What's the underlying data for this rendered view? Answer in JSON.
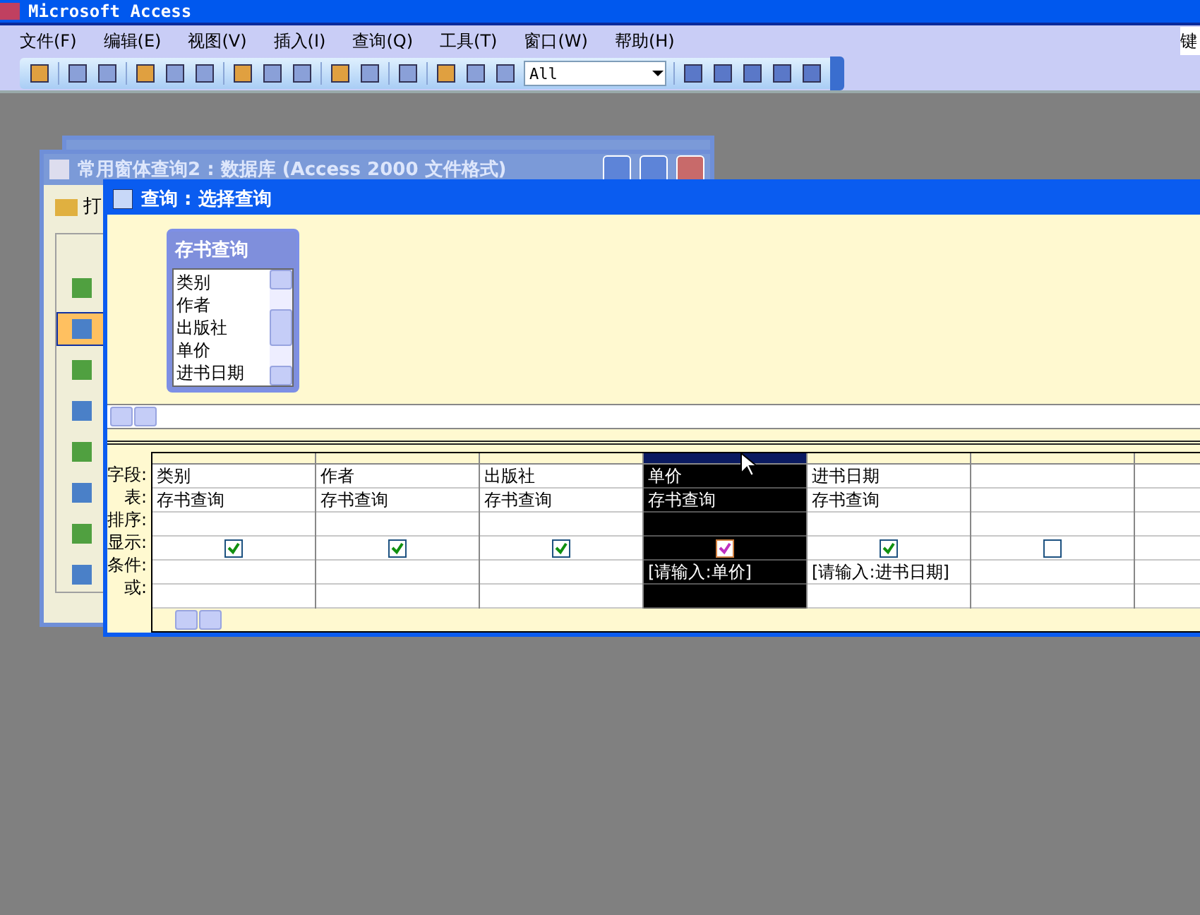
{
  "app_title": "Microsoft Access",
  "menu": [
    "文件(F)",
    "编辑(E)",
    "视图(V)",
    "插入(I)",
    "查询(Q)",
    "工具(T)",
    "窗口(W)",
    "帮助(H)"
  ],
  "toolbar": {
    "filter_value": "All"
  },
  "side_field": "键",
  "db_window": {
    "title": "常用窗体查询2 : 数据库 (Access 2000 文件格式)",
    "open_button": "打",
    "objects": [
      {
        "selected": false
      },
      {
        "selected": true
      },
      {
        "selected": false
      },
      {
        "selected": false
      },
      {
        "selected": false
      },
      {
        "selected": false
      },
      {
        "selected": false
      },
      {
        "selected": false
      }
    ]
  },
  "query_window": {
    "title": "查询 : 选择查询",
    "table": {
      "name": "存书查询",
      "fields": [
        "类别",
        "作者",
        "出版社",
        "单价",
        "进书日期"
      ]
    },
    "grid": {
      "row_labels": [
        "字段:",
        "表:",
        "排序:",
        "显示:",
        "条件:",
        "或:"
      ],
      "columns": [
        {
          "field": "类别",
          "table": "存书查询",
          "show": true,
          "selected": false
        },
        {
          "field": "作者",
          "table": "存书查询",
          "show": true,
          "selected": false
        },
        {
          "field": "出版社",
          "table": "存书查询",
          "show": true,
          "selected": false
        },
        {
          "field": "单价",
          "table": "存书查询",
          "show": true,
          "criteria": "[请输入:单价]",
          "selected": true
        },
        {
          "field": "进书日期",
          "table": "存书查询",
          "show": true,
          "criteria": "[请输入:进书日期]",
          "selected": false
        },
        {
          "show": false,
          "selected": false
        }
      ]
    }
  }
}
